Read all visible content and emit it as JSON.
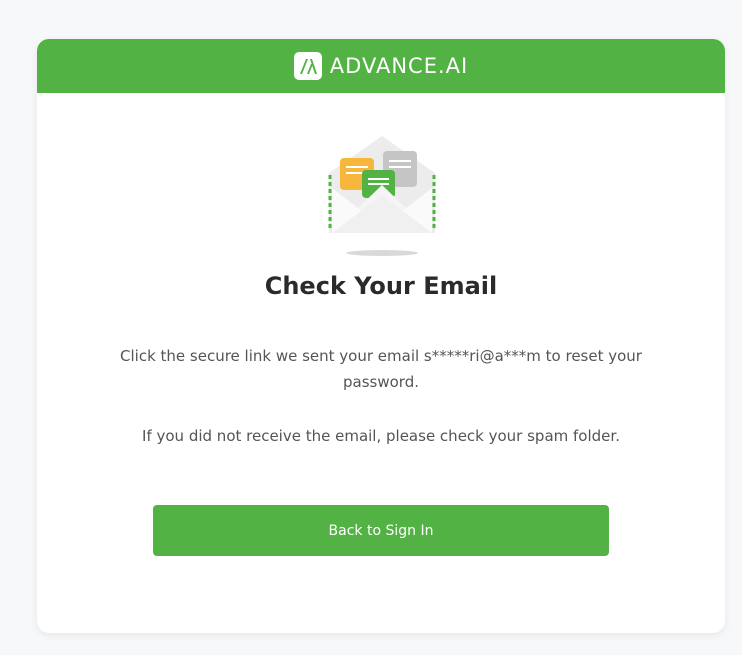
{
  "brand": {
    "name": "ADVANCE.AI",
    "color": "#52b243"
  },
  "main": {
    "title": "Check Your Email",
    "message": "Click the secure link we sent your email s*****ri@a***m to reset your password.",
    "hint": "If you did not receive the email, please check your spam folder.",
    "back_button_label": "Back to Sign In"
  },
  "icons": {
    "logo": "advance-ai-logo-icon",
    "illustration": "envelope-icon"
  }
}
